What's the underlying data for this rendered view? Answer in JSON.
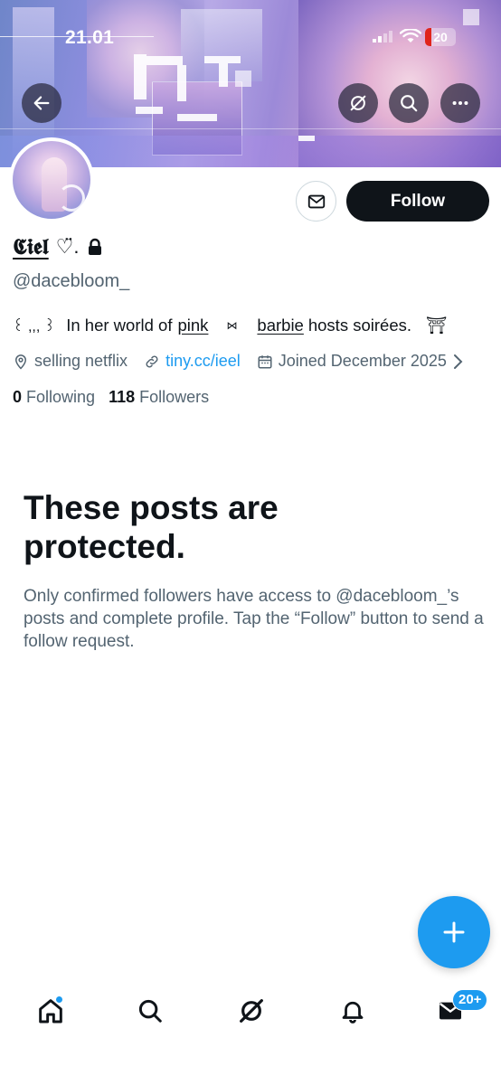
{
  "status_bar": {
    "time": "21.01",
    "battery": "20",
    "battery_level": 0.2
  },
  "colors": {
    "accent": "#1d9bf0",
    "text": "#0f1419",
    "secondary": "#536471",
    "battery_low": "#e0241b"
  },
  "header": {
    "back_icon": "arrow-left-icon",
    "grok_icon": "grok-icon",
    "search_icon": "search-icon",
    "more_icon": "more-icon"
  },
  "profile": {
    "display_name": "𝕮𝖎𝖊𝖑",
    "display_name_suffix": "♡̈.",
    "lock_icon": "lock-icon",
    "handle": "@dacebloom_",
    "bio": {
      "lead": "꒰ ,,, ꒱",
      "part1": "In her world of",
      "pink": "pink",
      "bow": "⋈",
      "barbie": "barbie",
      "part2": "hosts soirées.",
      "end": "⛩"
    },
    "location": "selling netflix",
    "link": "tiny.cc/ieel",
    "joined": "Joined December 2025",
    "following_count": "0",
    "following_label": "Following",
    "followers_count": "118",
    "followers_label": "Followers"
  },
  "buttons": {
    "follow": "Follow",
    "message_icon": "envelope-icon"
  },
  "protected": {
    "title": "These posts are protected.",
    "text": "Only confirmed followers have access to @dacebloom_’s posts and complete profile. Tap the “Follow” button to send a follow request."
  },
  "fab": {
    "icon": "plus-icon"
  },
  "bottom_nav": {
    "home_icon": "home-icon",
    "search_icon": "search-icon",
    "grok_icon": "grok-icon",
    "notifications_icon": "bell-icon",
    "messages_icon": "envelope-icon",
    "messages_badge": "20+"
  }
}
